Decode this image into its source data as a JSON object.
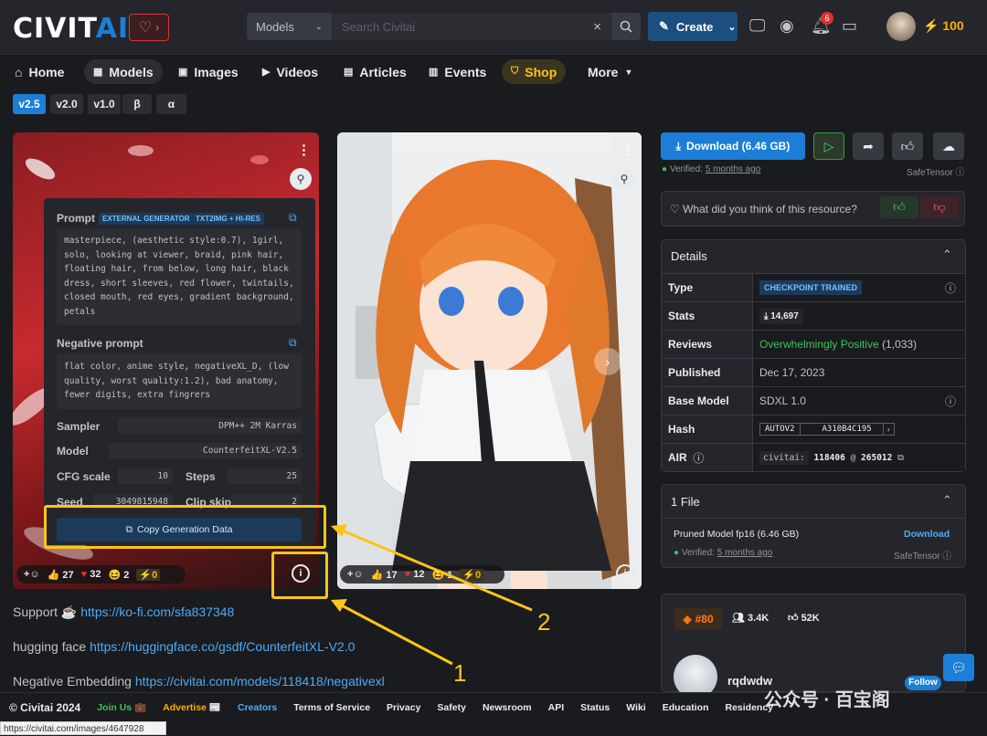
{
  "header": {
    "logo_a": "CIVIT",
    "logo_b": "AI",
    "search_model": "Models",
    "search_placeholder": "Search Civitai",
    "create_label": "Create",
    "notif_count": "6",
    "points": "100"
  },
  "nav": [
    {
      "label": "Home",
      "icon": "home-icon"
    },
    {
      "label": "Models",
      "icon": "grid-icon"
    },
    {
      "label": "Images",
      "icon": "image-icon"
    },
    {
      "label": "Videos",
      "icon": "video-icon"
    },
    {
      "label": "Articles",
      "icon": "article-icon"
    },
    {
      "label": "Events",
      "icon": "calendar-icon"
    },
    {
      "label": "Shop",
      "icon": "shop-icon"
    },
    {
      "label": "More",
      "icon": "chevron-down-icon"
    }
  ],
  "versions": [
    "v2.5",
    "v2.0",
    "v1.0",
    "β",
    "α"
  ],
  "gen": {
    "prompt_label": "Prompt",
    "tag1": "EXTERNAL GENERATOR",
    "tag2": "TXT2IMG + HI-RES",
    "prompt": "masterpiece, (aesthetic style:0.7), 1girl, solo, looking at viewer, braid, pink hair, floating hair, from below, long hair, black dress, short sleeves, red flower, twintails, closed mouth, red eyes, gradient background, petals",
    "neg_label": "Negative prompt",
    "neg": "flat color, anime style, negativeXL_D, (low quality, worst quality:1.2), bad anatomy, fewer digits, extra fingrers",
    "sampler_label": "Sampler",
    "sampler": "DPM++ 2M Karras",
    "model_label": "Model",
    "model": "CounterfeitXL-V2.5",
    "cfg_label": "CFG scale",
    "cfg": "10",
    "steps_label": "Steps",
    "steps": "25",
    "seed_label": "Seed",
    "seed": "3049815948",
    "clip_label": "Clip skip",
    "clip": "2",
    "copy_label": "Copy Generation Data"
  },
  "reactions1": {
    "like": "27",
    "heart": "32",
    "laugh": "2",
    "bolt": "0"
  },
  "reactions2": {
    "like": "17",
    "heart": "12",
    "laugh": "1",
    "bolt": "0"
  },
  "annotations": {
    "one": "1",
    "two": "2"
  },
  "desc": [
    {
      "text": "Support ☕ ",
      "link": "https://ko-fi.com/sfa837348"
    },
    {
      "text": "hugging face ",
      "link": "https://huggingface.co/gsdf/CounterfeitXL-V2.0"
    },
    {
      "text": "Negative Embedding ",
      "link": "https://civitai.com/models/118418/negativexl"
    }
  ],
  "right": {
    "download": "Download (6.46 GB)",
    "verified_prefix": "Verified:",
    "verified_when": "5 months ago",
    "safetensor": "SafeTensor",
    "feedback_q": "What did you think of this resource?",
    "details_title": "Details",
    "rows": [
      {
        "k": "Type",
        "v": "CHECKPOINT TRAINED"
      },
      {
        "k": "Stats",
        "v": "14,697"
      },
      {
        "k": "Reviews",
        "v": "Overwhelmingly Positive",
        "v2": "(1,033)"
      },
      {
        "k": "Published",
        "v": "Dec 17, 2023"
      },
      {
        "k": "Base Model",
        "v": "SDXL 1.0"
      },
      {
        "k": "Hash",
        "v": "AUTOV2",
        "v2": "A310B4C195"
      },
      {
        "k": "AIR",
        "v": "civitai:",
        "v2": "118406",
        "v3": "@",
        "v4": "265012"
      }
    ],
    "files_title": "1 File",
    "file_name": "Pruned Model fp16 (6.46 GB)",
    "file_download": "Download",
    "rank": "#80",
    "followers": "3.4K",
    "likes": "52K",
    "creator": "rqdwdw",
    "follow": "Follow"
  },
  "footer": [
    "© Civitai 2024",
    "Join Us 💼",
    "Advertise 📰",
    "Creators",
    "Terms of Service",
    "Privacy",
    "Safety",
    "Newsroom",
    "API",
    "Status",
    "Wiki",
    "Education",
    "Residency"
  ],
  "watermark": "公众号 · 百宝阁",
  "status_url": "https://civitai.com/images/4647928"
}
